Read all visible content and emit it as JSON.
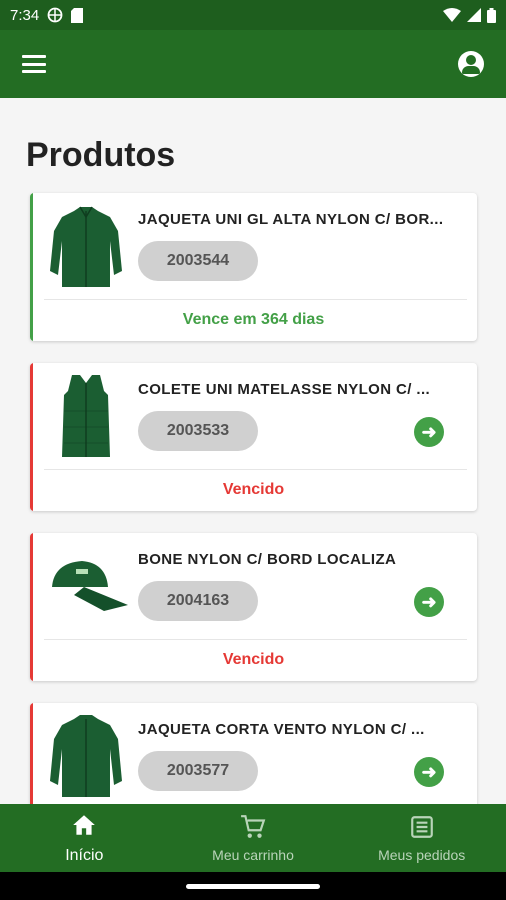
{
  "status_bar": {
    "time": "7:34"
  },
  "page": {
    "title": "Produtos"
  },
  "colors": {
    "primary": "#236d23",
    "ok": "#43a047",
    "expired": "#e53935"
  },
  "products": [
    {
      "name": "JAQUETA UNI GL ALTA NYLON C/ BOR...",
      "code": "2003544",
      "status": "Vence em 364 dias",
      "state": "ok",
      "icon": "jacket-icon",
      "has_action": false
    },
    {
      "name": "COLETE UNI MATELASSE NYLON C/ ...",
      "code": "2003533",
      "status": "Vencido",
      "state": "expired",
      "icon": "vest-icon",
      "has_action": true
    },
    {
      "name": "BONE NYLON C/ BORD LOCALIZA",
      "code": "2004163",
      "status": "Vencido",
      "state": "expired",
      "icon": "cap-icon",
      "has_action": true
    },
    {
      "name": "JAQUETA CORTA VENTO NYLON C/ ...",
      "code": "2003577",
      "status": "",
      "state": "expired",
      "icon": "windbreaker-icon",
      "has_action": true
    }
  ],
  "bottom_nav": {
    "items": [
      {
        "label": "Início",
        "icon": "home-icon",
        "active": true
      },
      {
        "label": "Meu carrinho",
        "icon": "cart-icon",
        "active": false
      },
      {
        "label": "Meus pedidos",
        "icon": "orders-icon",
        "active": false
      }
    ]
  }
}
